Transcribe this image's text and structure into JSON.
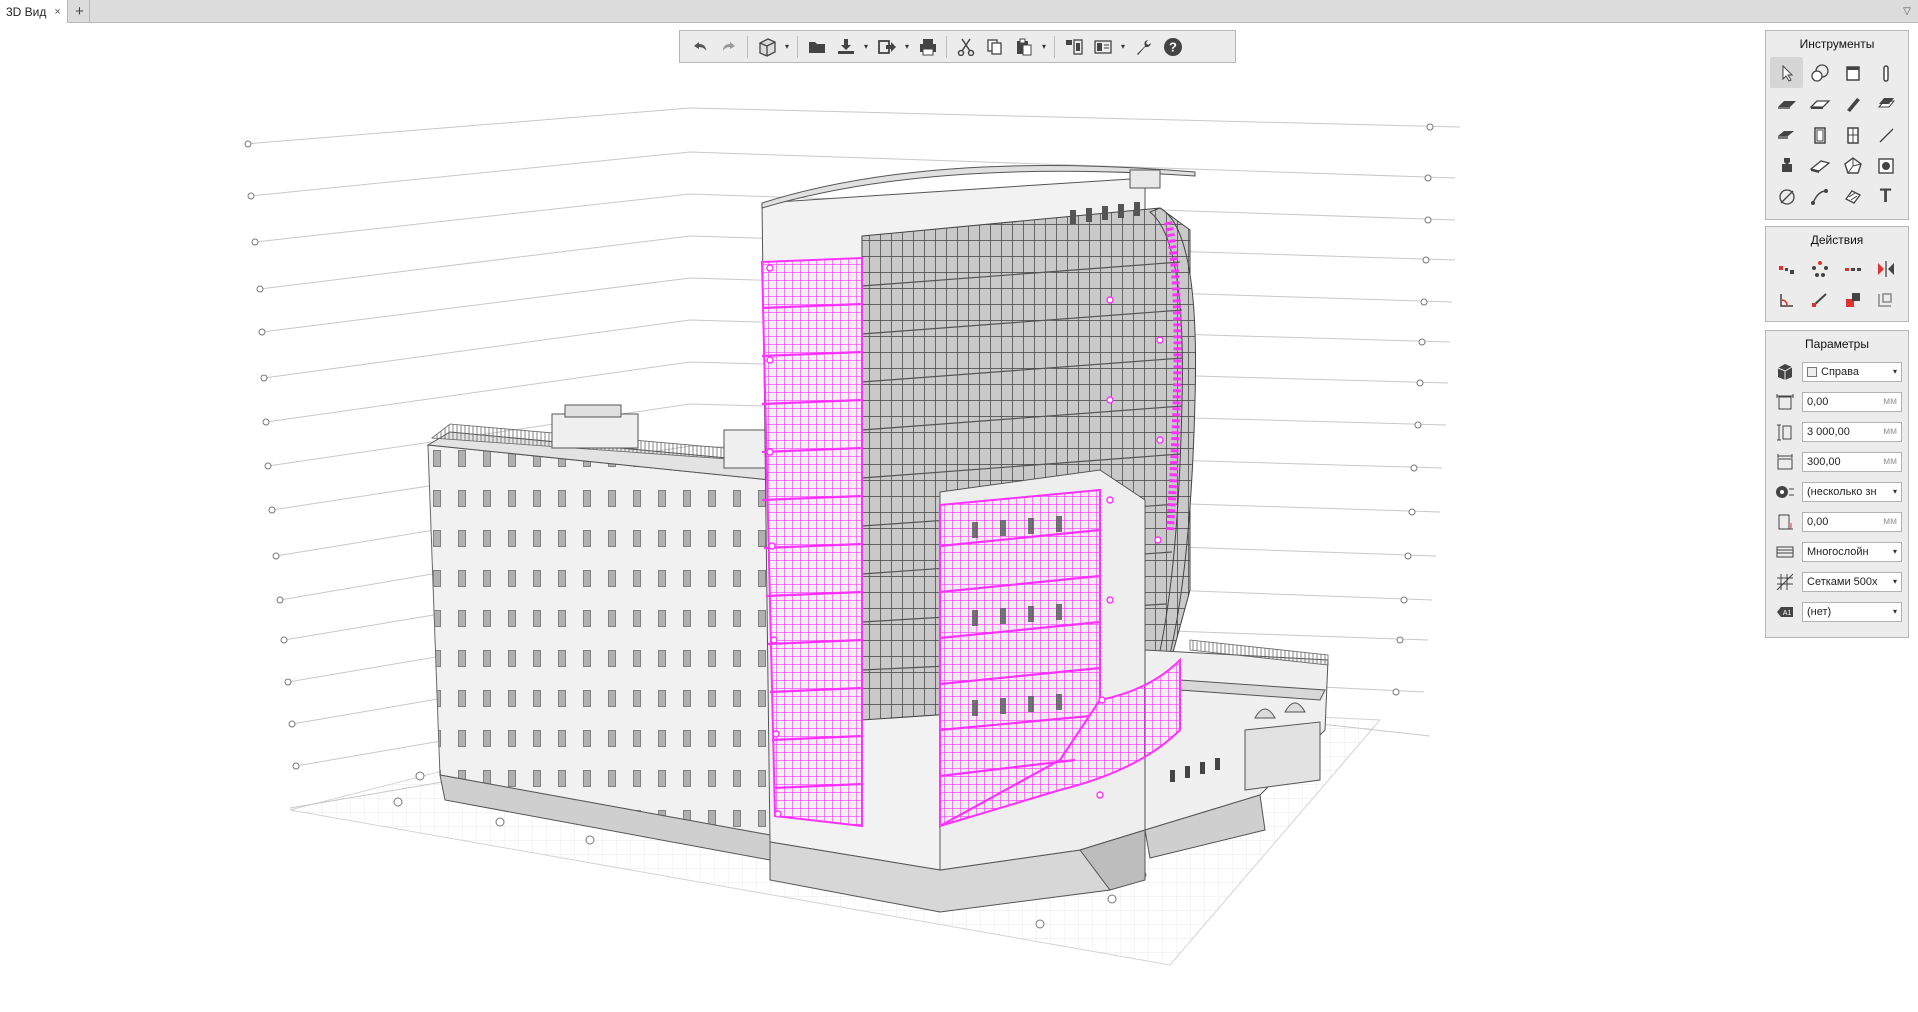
{
  "tabs": {
    "active_label": "3D Вид",
    "close_glyph": "×",
    "add_glyph": "+",
    "menu_glyph": "▽"
  },
  "toolbar": {
    "buttons": [
      "undo-icon",
      "redo-icon",
      "3d-box-icon",
      "folder-icon",
      "import-icon",
      "export-icon",
      "print-icon",
      "cut-icon",
      "copy-icon",
      "paste-icon",
      "layout-icon",
      "views-icon",
      "settings-wrench-icon",
      "help-icon"
    ],
    "caret": "▾"
  },
  "panels": {
    "tools": {
      "title": "Инструменты",
      "icons": [
        "select-arrow-icon",
        "grid-axis-icon",
        "wall-icon",
        "column-icon",
        "slab-icon",
        "beam-icon",
        "roof-icon",
        "stair-icon",
        "floor-icon",
        "door-icon",
        "window-icon",
        "line-icon",
        "railing-icon",
        "ramp-icon",
        "shell-icon",
        "zone-icon",
        "dimension-icon",
        "curtain-wall-icon",
        "hatch-icon",
        "text-icon"
      ],
      "text_glyph": "T"
    },
    "actions": {
      "title": "Действия",
      "icons": [
        "move-icon",
        "rotate-icon",
        "array-icon",
        "mirror-icon",
        "trim-icon",
        "stretch-icon",
        "offset-icon",
        "copy-transform-icon"
      ]
    },
    "params": {
      "title": "Параметры",
      "view_value": "Справа",
      "offset_value": "0,00",
      "height_value": "3 000,00",
      "thickness_value": "300,00",
      "material_value": "(несколько зн",
      "elevation_value": "0,00",
      "structure_value": "Многослойн",
      "grid_value": "Сетками 500х",
      "label_value": "(нет)",
      "unit": "мм",
      "caret": "▾"
    }
  },
  "colors": {
    "accent_magenta": "#ff33ff",
    "building_light": "#f2f2f2",
    "building_mid": "#d6d6d6",
    "building_dark": "#6e6e6e",
    "glass": "#8a8a8a"
  }
}
